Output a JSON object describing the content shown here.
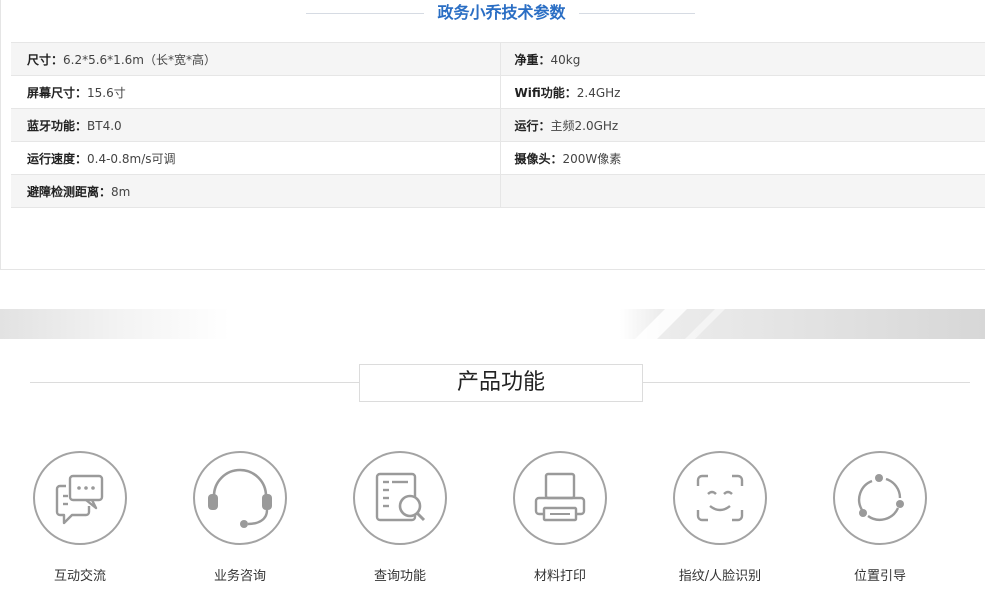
{
  "spec": {
    "title": "政务小乔技术参数",
    "rows": [
      [
        {
          "key": "尺寸：",
          "value": "6.2*5.6*1.6m（长*宽*高）"
        },
        {
          "key": "净重：",
          "value": "40kg"
        }
      ],
      [
        {
          "key": "屏幕尺寸：",
          "value": "15.6寸"
        },
        {
          "key": "Wifi功能：",
          "value": "2.4GHz"
        }
      ],
      [
        {
          "key": "蓝牙功能：",
          "value": "BT4.0"
        },
        {
          "key": "运行：",
          "value": "主频2.0GHz"
        }
      ],
      [
        {
          "key": "运行速度：",
          "value": "0.4-0.8m/s可调"
        },
        {
          "key": "摄像头：",
          "value": "200W像素"
        }
      ],
      [
        {
          "key": "避障检测距离：",
          "value": "8m"
        },
        {
          "key": "",
          "value": ""
        }
      ]
    ]
  },
  "functions": {
    "title": "产品功能",
    "items": [
      {
        "label": "互动交流",
        "icon": "chat-bubbles-icon"
      },
      {
        "label": "业务咨询",
        "icon": "headset-icon"
      },
      {
        "label": "查询功能",
        "icon": "search-document-icon"
      },
      {
        "label": "材料打印",
        "icon": "printer-icon"
      },
      {
        "label": "指纹/人脸识别",
        "icon": "face-scan-icon"
      },
      {
        "label": "位置引导",
        "icon": "location-guide-icon"
      }
    ]
  },
  "colors": {
    "accent": "#2a6ec4",
    "icon_stroke": "#9a9a9a",
    "row_alt": "#f5f5f5"
  }
}
